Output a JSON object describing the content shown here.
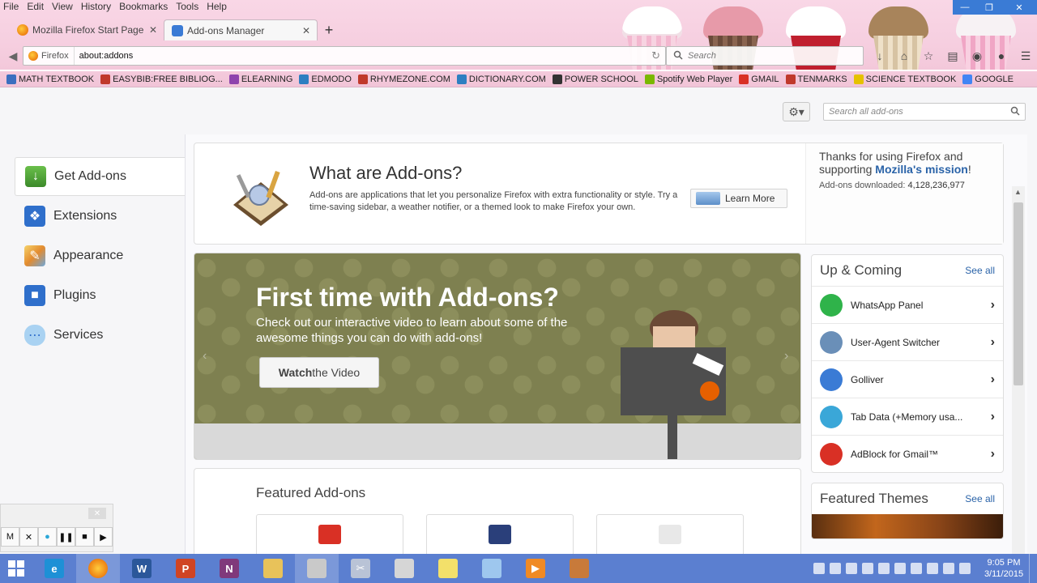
{
  "menu": [
    "File",
    "Edit",
    "View",
    "History",
    "Bookmarks",
    "Tools",
    "Help"
  ],
  "tabs": [
    {
      "label": "Mozilla Firefox Start Page",
      "active": false
    },
    {
      "label": "Add-ons Manager",
      "active": true
    }
  ],
  "navbar": {
    "identity": "Firefox",
    "url": "about:addons",
    "search_placeholder": "Search"
  },
  "bookmarks": [
    {
      "label": "MATH TEXTBOOK",
      "color": "#3b6fbf"
    },
    {
      "label": "EASYBIB:FREE BIBLIOG...",
      "color": "#c0392b"
    },
    {
      "label": "ELEARNING",
      "color": "#8e44ad"
    },
    {
      "label": "EDMODO",
      "color": "#2d7fc1"
    },
    {
      "label": "RHYMEZONE.COM",
      "color": "#c0392b"
    },
    {
      "label": "DICTIONARY.COM",
      "color": "#2d7fc1"
    },
    {
      "label": "POWER SCHOOL",
      "color": "#333333"
    },
    {
      "label": "Spotify Web Player",
      "color": "#7ab800"
    },
    {
      "label": "GMAIL",
      "color": "#d93025"
    },
    {
      "label": "TENMARKS",
      "color": "#c0392b"
    },
    {
      "label": "SCIENCE TEXTBOOK",
      "color": "#e5c200"
    },
    {
      "label": "GOOGLE",
      "color": "#4285f4"
    }
  ],
  "addons": {
    "search_placeholder": "Search all add-ons",
    "categories": [
      {
        "label": "Get Add-ons",
        "icon": "download-icon",
        "selected": true
      },
      {
        "label": "Extensions",
        "icon": "puzzle-icon",
        "selected": false
      },
      {
        "label": "Appearance",
        "icon": "paintbrush-icon",
        "selected": false
      },
      {
        "label": "Plugins",
        "icon": "plugin-block-icon",
        "selected": false
      },
      {
        "label": "Services",
        "icon": "chat-cloud-icon",
        "selected": false
      }
    ],
    "intro": {
      "title": "What are Add-ons?",
      "text": "Add-ons are applications that let you personalize Firefox with extra functionality or style. Try a time-saving sidebar, a weather notifier, or a themed look to make Firefox your own.",
      "learn_more": "Learn More",
      "thanks_prefix": "Thanks for using Firefox and supporting ",
      "thanks_link": "Mozilla's mission",
      "thanks_suffix": "!",
      "downloads_label": "Add-ons downloaded: ",
      "downloads_count": "4,128,236,977"
    },
    "promo": {
      "title": "First time with Add-ons?",
      "text": "Check out our interactive video to learn about some of the awesome things you can do with add-ons!",
      "button_bold": "Watch",
      "button_rest": " the Video"
    },
    "featured": {
      "title": "Featured Add-ons"
    },
    "up_coming": {
      "title": "Up & Coming",
      "see_all": "See all",
      "items": [
        {
          "name": "WhatsApp Panel",
          "color": "#2fb34a"
        },
        {
          "name": "User-Agent Switcher",
          "color": "#6a8fb8"
        },
        {
          "name": "Golliver",
          "color": "#3a7bd5"
        },
        {
          "name": "Tab Data (+Memory usa...",
          "color": "#3aa7d8"
        },
        {
          "name": "AdBlock for Gmail™",
          "color": "#d93025"
        }
      ]
    },
    "featured_themes": {
      "title": "Featured Themes",
      "see_all": "See all"
    }
  },
  "player": {
    "controls": [
      "M",
      "✕",
      "●",
      "❚❚",
      "■",
      "▶"
    ]
  },
  "taskbar": {
    "time": "9:05 PM",
    "date": "3/11/2015"
  }
}
